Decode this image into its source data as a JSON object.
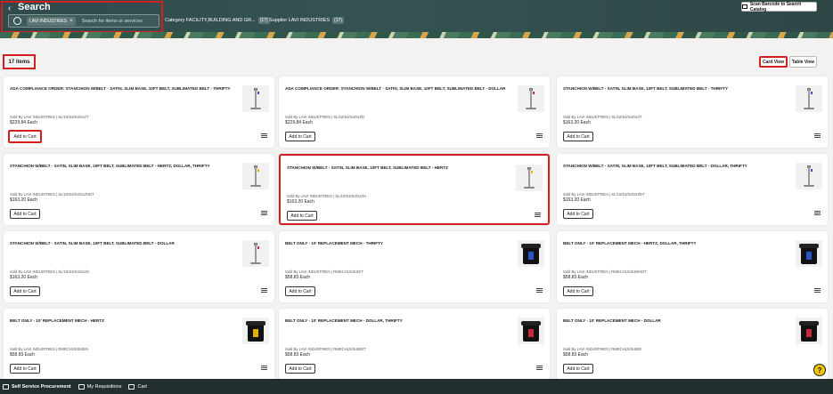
{
  "header": {
    "title": "Search",
    "back_glyph": "‹",
    "chip_label": "LAVI INDUSTRIES",
    "search_placeholder": "Search for items or services",
    "filters": [
      {
        "label": "Category FACILITY,BUILDING AND GR...",
        "count": "(17)"
      },
      {
        "label": "Supplier LAVI INDUSTRIES",
        "count": "(17)"
      }
    ],
    "scan_label": "Scan Barcode to Search Catalog"
  },
  "toolbar": {
    "items_count": "17 items",
    "card_view": "Card View",
    "table_view": "Table View"
  },
  "colors": {
    "highlight": "#d21f1f",
    "header_bg": "#2f4a4a",
    "footer_bg": "#232f2f"
  },
  "cards": [
    {
      "title": "ADA COMPLIANCE ORDER: STANCHION W/BELT - SATIN, SLIM BASE, 10FT BELT, SUBLIMATED BELT - THRIFTY",
      "sold": "Sold By LAVI INDUSTRIES | SL/10/S4/S4/SU/T",
      "price": "$229.84 Each",
      "add": "Add to Cart",
      "image": "stanchion",
      "tag_color": "#2a55c8"
    },
    {
      "title": "ADA COMPLIANCE ORDER: STANCHION W/BELT - SATIN, SLIM BASE, 10FT BELT, SUBLIMATED BELT - DOLLAR",
      "sold": "Sold By LAVI INDUSTRIES | SL/10/S4/S4/SU/D",
      "price": "$229.84 Each",
      "add": "Add to Cart",
      "image": "stanchion",
      "tag_color": "#c8283a"
    },
    {
      "title": "STANCHION W/BELT - SATIN, SLIM BASE, 10FT BELT, SUBLIMATED BELT - THRIFTY",
      "sold": "Sold By LAVI INDUSTRIES | SL/10/S4/S4/SU/T",
      "price": "$163.20 Each",
      "add": "Add to Cart",
      "image": "stanchion",
      "tag_color": "#2a55c8"
    },
    {
      "title": "STANCHION W/BELT - SATIN, SLIM BASE, 10FT BELT, SUBLIMATED BELT - HERTZ, DOLLAR, THRIFTY",
      "sold": "Sold By LAVI INDUSTRIES | SL/10/S4/S4/SU/HDT",
      "price": "$163.20 Each",
      "add": "Add to Cart",
      "image": "stanchion",
      "tag_color": "#e0b000"
    },
    {
      "title": "STANCHION W/BELT - SATIN, SLIM BASE, 10FT BELT, SUBLIMATED BELT - HERTZ",
      "sold": "Sold By LAVI INDUSTRIES | SL/10/S4/S4/SU/H",
      "price": "$163.20 Each",
      "add": "Add to Cart",
      "image": "stanchion",
      "tag_color": "#e0b000"
    },
    {
      "title": "STANCHION W/BELT - SATIN, SLIM BASE, 10FT BELT, SUBLIMATED BELT - DOLLAR, THRIFTY",
      "sold": "Sold By LAVI INDUSTRIES | SL/10/S4/S4/SU/DT",
      "price": "$163.20 Each",
      "add": "Add to Cart",
      "image": "stanchion",
      "tag_color": "#2a55c8"
    },
    {
      "title": "STANCHION W/BELT - SATIN, SLIM BASE, 10FT BELT, SUBLIMATED BELT - DOLLAR",
      "sold": "Sold By LAVI INDUSTRIES | SL/10/S4/S4/SU/D",
      "price": "$163.20 Each",
      "add": "Add to Cart",
      "image": "stanchion",
      "tag_color": "#c8283a"
    },
    {
      "title": "BELT ONLY - 10' REPLACEMENT MECH - THRIFTY",
      "sold": "Sold By LAVI INDUSTRIES | RMECH10/SUB/T",
      "price": "$58.83 Each",
      "add": "Add to Cart",
      "image": "bin",
      "tag_color": "#2a55c8"
    },
    {
      "title": "BELT ONLY - 10' REPLACEMENT MECH - HERTZ, DOLLAR, THRIFTY",
      "sold": "Sold By LAVI INDUSTRIES | RMECH10/SUB/HDT",
      "price": "$58.83 Each",
      "add": "Add to Cart",
      "image": "bin",
      "tag_color": "#2a55c8"
    },
    {
      "title": "BELT ONLY - 10' REPLACEMENT MECH - HERTZ",
      "sold": "Sold By LAVI INDUSTRIES | RMECH10/SUB/H",
      "price": "$58.83 Each",
      "add": "Add to Cart",
      "image": "bin",
      "tag_color": "#e0b000"
    },
    {
      "title": "BELT ONLY - 10' REPLACEMENT MECH - DOLLAR, THRIFTY",
      "sold": "Sold By LAVI INDUSTRIES | RMECH10/SUB/DT",
      "price": "$58.83 Each",
      "add": "Add to Cart",
      "image": "bin",
      "tag_color": "#c8283a"
    },
    {
      "title": "BELT ONLY - 10' REPLACEMENT MECH - DOLLAR",
      "sold": "Sold By LAVI INDUSTRIES | RMECH10/SUB/D",
      "price": "$58.83 Each",
      "add": "Add to Cart",
      "image": "bin",
      "tag_color": "#c8283a"
    }
  ],
  "footer": {
    "self_service": "Self Service Procurement",
    "my_requisitions": "My Requisitions",
    "cart": "Cart"
  },
  "help_glyph": "?"
}
